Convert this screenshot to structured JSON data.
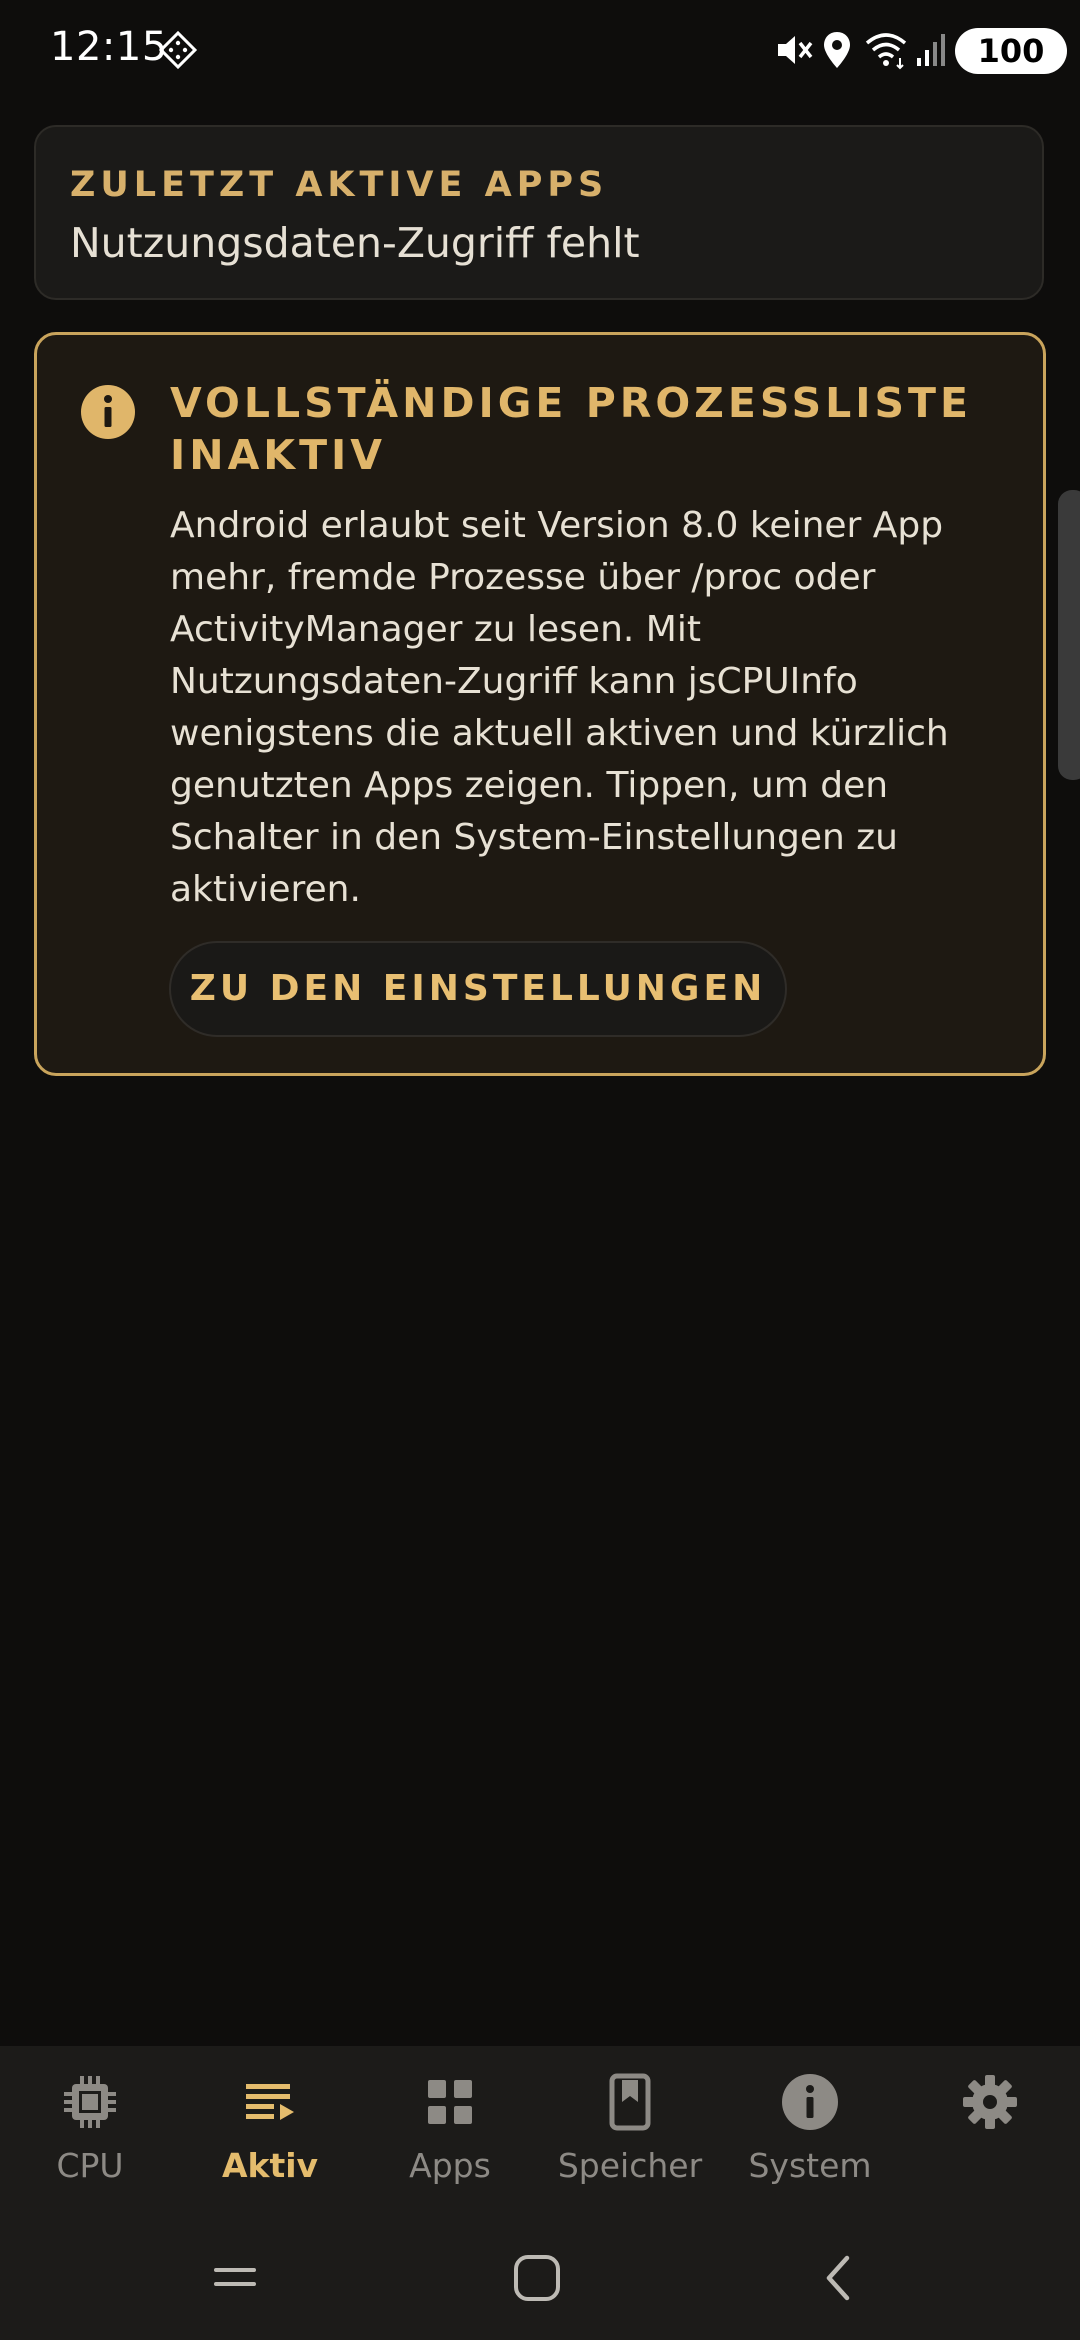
{
  "status_bar": {
    "time": "12:15",
    "battery": "100",
    "icons": [
      "app-notification-icon",
      "mute-icon",
      "location-icon",
      "wifi-icon",
      "signal-icon"
    ]
  },
  "recent_apps_card": {
    "title": "ZULETZT AKTIVE APPS",
    "subtitle": "Nutzungsdaten-Zugriff fehlt"
  },
  "info_card": {
    "icon": "info-icon",
    "title": "VOLLSTÄNDIGE PROZESSLISTE INAKTIV",
    "body": "Android erlaubt seit Version 8.0 keiner App mehr, fremde Prozesse über /proc oder ActivityManager zu lesen. Mit Nutzungsdaten-Zugriff kann jsCPUInfo wenigstens die aktuell aktiven und kürzlich genutzten Apps zeigen. Tippen, um den Schalter in den System-Einstellungen zu aktivieren.",
    "button_label": "ZU DEN EINSTELLUNGEN"
  },
  "bottom_nav": {
    "items": [
      {
        "label": "CPU",
        "icon": "chip-icon",
        "active": false
      },
      {
        "label": "Aktiv",
        "icon": "list-play-icon",
        "active": true
      },
      {
        "label": "Apps",
        "icon": "grid-icon",
        "active": false
      },
      {
        "label": "Speicher",
        "icon": "storage-icon",
        "active": false
      },
      {
        "label": "System",
        "icon": "info-icon",
        "active": false
      },
      {
        "label": "",
        "icon": "gear-icon",
        "active": false
      }
    ]
  },
  "system_nav": {
    "buttons": [
      "recents-icon",
      "home-icon",
      "back-icon"
    ]
  },
  "colors": {
    "background": "#0e0d0c",
    "accent": "#e0b66a",
    "card": "#1b1a18",
    "info_card_border": "#c9a45c",
    "nav_inactive": "#8d8a85"
  }
}
